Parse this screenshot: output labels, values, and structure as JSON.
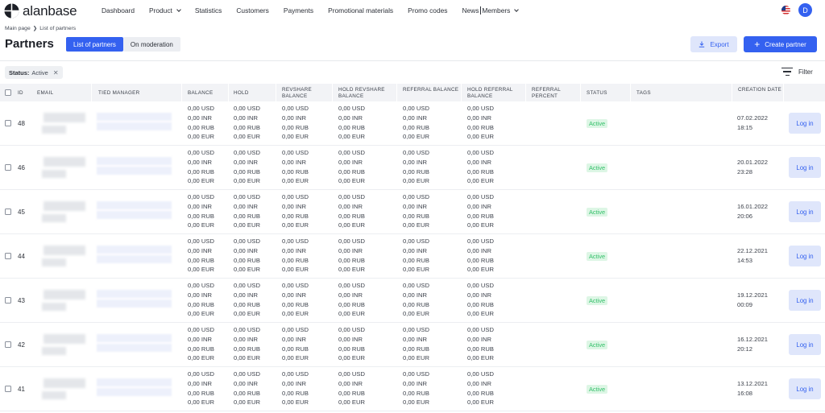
{
  "app": {
    "logo_text": "alanbase",
    "avatar_letter": "D"
  },
  "nav": {
    "items": [
      {
        "label": "Dashboard",
        "dropdown": false
      },
      {
        "label": "Product",
        "dropdown": true
      },
      {
        "label": "Statistics",
        "dropdown": false
      },
      {
        "label": "Customers",
        "dropdown": false
      },
      {
        "label": "Payments",
        "dropdown": false
      },
      {
        "label": "Promotional materials",
        "dropdown": false
      },
      {
        "label": "Promo codes",
        "dropdown": false
      },
      {
        "label": "News",
        "dropdown": false
      },
      {
        "label": "Members",
        "dropdown": true
      }
    ]
  },
  "breadcrumb": {
    "home": "Main page",
    "current": "List of partners"
  },
  "page": {
    "title": "Partners",
    "tab_list": "List of partners",
    "tab_moderation": "On moderation",
    "export_label": "Export",
    "create_label": "Create partner",
    "filter_label": "Filter"
  },
  "filter_chip": {
    "key": "Status:",
    "value": "Active"
  },
  "table": {
    "columns": {
      "id": "ID",
      "email": "Email",
      "manager": "Tied manager",
      "balance": "Balance",
      "hold": "Hold",
      "revshare": "Revshare balance",
      "hold_revshare": "Hold revshare balance",
      "referral": "Referral balance",
      "hold_referral": "Hold referral balance",
      "referral_percent": "Referral percent",
      "status": "Status",
      "tags": "Tags",
      "creation_date": "Creation date"
    },
    "currency_lines": [
      "0,00 USD",
      "0,00 INR",
      "0,00 RUB",
      "0,00 EUR"
    ],
    "login_label": "Log in",
    "rows": [
      {
        "id": "48",
        "status": "Active",
        "date": "07.02.2022",
        "time": "18:15"
      },
      {
        "id": "46",
        "status": "Active",
        "date": "20.01.2022",
        "time": "23:28"
      },
      {
        "id": "45",
        "status": "Active",
        "date": "16.01.2022",
        "time": "20:06"
      },
      {
        "id": "44",
        "status": "Active",
        "date": "22.12.2021",
        "time": "14:53"
      },
      {
        "id": "43",
        "status": "Active",
        "date": "19.12.2021",
        "time": "00:09"
      },
      {
        "id": "42",
        "status": "Active",
        "date": "16.12.2021",
        "time": "20:12"
      },
      {
        "id": "41",
        "status": "Active",
        "date": "13.12.2021",
        "time": "16:08"
      }
    ]
  },
  "colors": {
    "accent": "#3461f0",
    "accent_light": "#dfe6fb",
    "status_active_bg": "#ddf6e5",
    "status_active_text": "#34c06a",
    "header_bg": "#f2f3f6"
  }
}
